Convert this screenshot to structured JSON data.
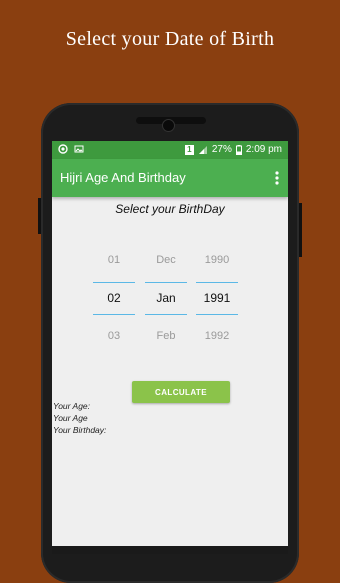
{
  "promo": {
    "title": "Select your Date of Birth"
  },
  "status_bar": {
    "sim_label": "1",
    "battery": "27%",
    "time": "2:09 pm",
    "bg_color": "#3e9a3e"
  },
  "app_bar": {
    "title": "Hijri Age And Birthday",
    "menu_icon": "overflow-menu-icon",
    "color": "#4caf50"
  },
  "screen": {
    "subtitle": "Select your BirthDay"
  },
  "date_picker": {
    "day": {
      "prev": "01",
      "selected": "02",
      "next": "03"
    },
    "month": {
      "prev": "Dec",
      "selected": "Jan",
      "next": "Feb"
    },
    "year": {
      "prev": "1990",
      "selected": "1991",
      "next": "1992"
    },
    "divider_color": "#5bb8e6"
  },
  "calculate_button": {
    "label": "CALCULATE",
    "color": "#8bc34a"
  },
  "results": {
    "age_label": "Your Age:",
    "age_label_2": "Your Age",
    "birthday_label": "Your Birthday:"
  }
}
